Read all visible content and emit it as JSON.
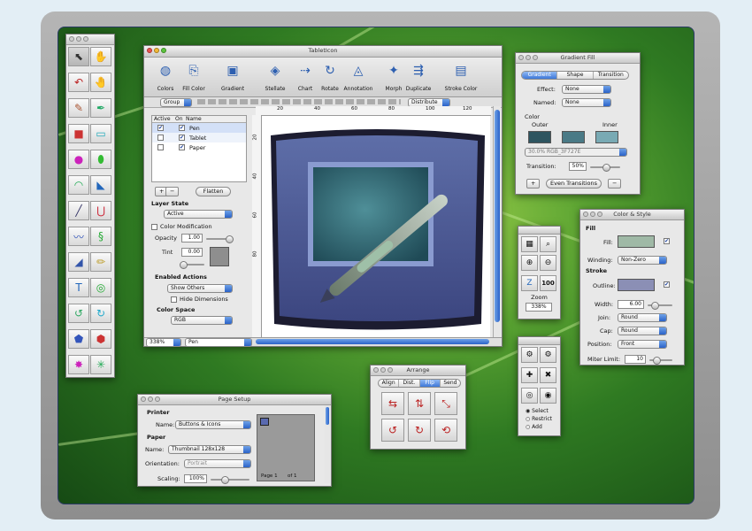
{
  "main": {
    "title": "TabletIcon",
    "toolbar": [
      "Colors",
      "Fill Color",
      "Gradient",
      "Stellate",
      "Chart",
      "Rotate",
      "Annotation",
      "Morph",
      "Duplicate",
      "Stroke Color"
    ],
    "bar2": {
      "group": "Group",
      "distribute": "Distribute"
    },
    "ruler_h": [
      "20",
      "40",
      "60",
      "80",
      "100",
      "120"
    ],
    "ruler_v": [
      "20",
      "40",
      "60",
      "80"
    ],
    "layers": {
      "headers": [
        "Active",
        "On",
        "Name"
      ],
      "rows": [
        {
          "name": "Pen"
        },
        {
          "name": "Tablet"
        },
        {
          "name": "Paper"
        }
      ],
      "flatten": "Flatten",
      "plus": "+",
      "minus": "−"
    },
    "layer_state": {
      "label": "Layer State",
      "value": "Active"
    },
    "color_mod": {
      "label": "Color Modification",
      "opacity_label": "Opacity",
      "opacity": "1.00",
      "tint_label": "Tint",
      "tint": "0.00"
    },
    "enabled_actions": {
      "label": "Enabled Actions",
      "value": "Show Others",
      "hide": "Hide Dimensions"
    },
    "color_space": {
      "label": "Color Space",
      "value": "RGB"
    },
    "status": {
      "zoom": "338%",
      "layer": "Pen"
    }
  },
  "gradient": {
    "title": "Gradient Fill",
    "tabs": [
      "Gradient",
      "Shape",
      "Transition"
    ],
    "effect_label": "Effect:",
    "effect": "None",
    "named_label": "Named:",
    "named": "None",
    "color_label": "Color",
    "outer": "Outer",
    "inner": "Inner",
    "swatch_value": "30.0% RGB_3F727E",
    "transition_label": "Transition:",
    "transition": "50%",
    "plus": "+",
    "minus": "−",
    "even": "Even Transitions",
    "colors": {
      "outer": "#2e5560",
      "mid": "#4a7a86",
      "inner": "#79aab4"
    }
  },
  "zoom": {
    "label": "Zoom",
    "value": "338%",
    "z100": "100"
  },
  "colorstyle": {
    "title": "Color & Style",
    "fill_h": "Fill",
    "fill_label": "Fill:",
    "winding_label": "Winding:",
    "winding": "Non-Zero",
    "stroke_h": "Stroke",
    "outline_label": "Outline:",
    "width_label": "Width:",
    "width": "6.00",
    "join_label": "Join:",
    "join": "Round",
    "cap_label": "Cap:",
    "cap": "Round",
    "position_label": "Position:",
    "position": "Front",
    "miter_label": "Miter Limit:",
    "miter": "10",
    "colors": {
      "fill": "#9fb9a6",
      "outline": "#8b8fb5"
    }
  },
  "select_panel": {
    "options": [
      "Select",
      "Restrict",
      "Add"
    ]
  },
  "arrange": {
    "title": "Arrange",
    "tabs": [
      "Align",
      "Dist.",
      "Flip",
      "Send"
    ]
  },
  "pagesetup": {
    "title": "Page Setup",
    "printer_h": "Printer",
    "name_label": "Name:",
    "printer": "Buttons & Icons",
    "paper_h": "Paper",
    "paper_name_label": "Name:",
    "paper": "Thumbnail 128x128",
    "orientation_label": "Orientation:",
    "orientation": "Portrait",
    "scaling_label": "Scaling:",
    "scaling": "100%",
    "page": "Page 1",
    "of": "of 1"
  },
  "tools": [
    "⬉",
    "✋",
    "↶",
    "🤚",
    "✎",
    "✒",
    "■",
    "▭",
    "●",
    "⬮",
    "◠",
    "◣",
    "╱",
    "⋃",
    "〰",
    "§",
    "◢",
    "✏",
    "T",
    "◎",
    "↺",
    "↻",
    "⬟",
    "⬢",
    "✸",
    "✳"
  ],
  "tool_colors": [
    "#333",
    "#555",
    "#b22",
    "#444",
    "#a53",
    "#2a6",
    "#c33",
    "#2ab",
    "#c2b",
    "#3b3",
    "#2a5",
    "#26b",
    "#336",
    "#c23",
    "#35b",
    "#2a3",
    "#35a",
    "#b92",
    "#26b",
    "#2a3",
    "#3a6",
    "#2ac",
    "#35b",
    "#c33",
    "#c2b",
    "#2a5"
  ]
}
